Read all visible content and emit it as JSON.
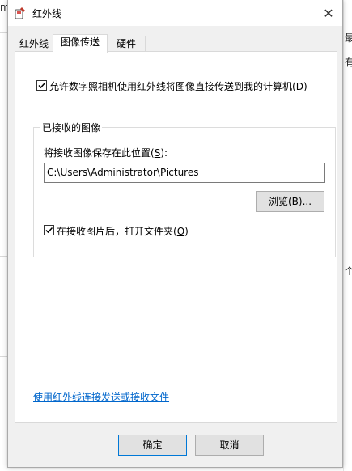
{
  "window": {
    "title": "红外线",
    "close_glyph": "✕"
  },
  "tabs": [
    {
      "label": "红外线"
    },
    {
      "label": "图像传送"
    },
    {
      "label": "硬件"
    }
  ],
  "options": {
    "allow_camera_label_pre": "允许数字照相机使用红外线将图像直接传送到我的计算机(",
    "allow_camera_label_key": "D",
    "allow_camera_label_post": ")",
    "allow_camera_checked": true
  },
  "received_images": {
    "group_title": "已接收的图像",
    "save_location_label_pre": "将接收图像保存在此位置(",
    "save_location_label_key": "S",
    "save_location_label_post": "):",
    "save_path": "C:\\Users\\Administrator\\Pictures",
    "browse_label_pre": "浏览(",
    "browse_label_key": "B",
    "browse_label_post": ")...",
    "open_folder_label_pre": "在接收图片后，打开文件夹(",
    "open_folder_label_key": "O",
    "open_folder_label_post": ")",
    "open_folder_checked": true
  },
  "link_text": "使用红外线连接发送或接收文件",
  "footer": {
    "ok_label": "确定",
    "cancel_label": "取消"
  },
  "background": {
    "fragment_top_left": "m",
    "fragment_right_1": "最",
    "fragment_right_2": "有",
    "fragment_right_3": "个"
  }
}
